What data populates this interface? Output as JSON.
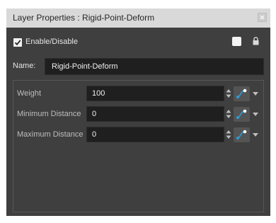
{
  "window": {
    "title": "Layer Properties : Rigid-Point-Deform"
  },
  "enable": {
    "label": "Enable/Disable",
    "checked": true
  },
  "name": {
    "label": "Name:",
    "value": "Rigid-Point-Deform"
  },
  "params": [
    {
      "label": "Weight",
      "value": "100"
    },
    {
      "label": "Minimum Distance",
      "value": "0"
    },
    {
      "label": "Maximum Distance",
      "value": "0"
    }
  ],
  "icons": {
    "close": "close-icon",
    "checkbox": "checkmark-icon",
    "color_swatch": "color-swatch",
    "lock": "lock-icon",
    "spinner": "spinner-arrows-icon",
    "function": "function-curve-icon",
    "dropdown": "chevron-down-icon"
  },
  "colors": {
    "window_bg": "#3f3f3f",
    "titlebar_bg": "#d9d9d9",
    "field_bg": "#1f1f1f",
    "text": "#e4e4e4"
  }
}
